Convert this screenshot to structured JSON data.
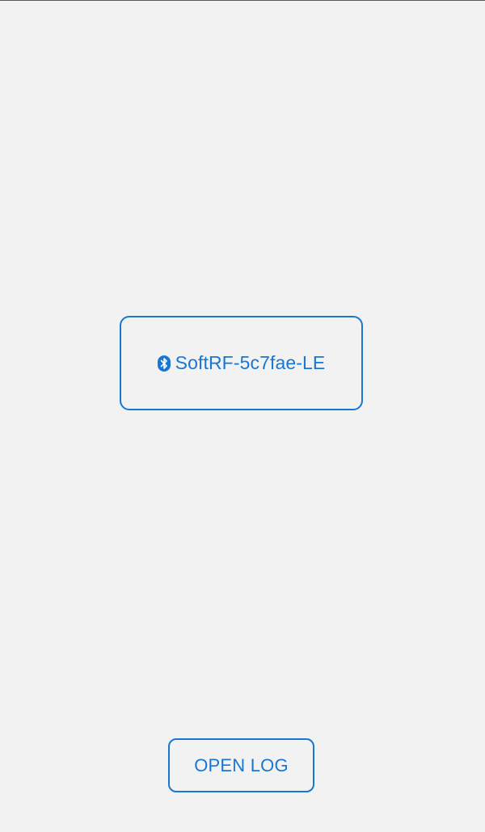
{
  "device_button": {
    "icon": "bluetooth-icon",
    "label": "SoftRF-5c7fae-LE"
  },
  "open_log_button": {
    "label": "OPEN LOG"
  },
  "colors": {
    "background": "#f2f2f2",
    "accent": "#1976d2"
  }
}
